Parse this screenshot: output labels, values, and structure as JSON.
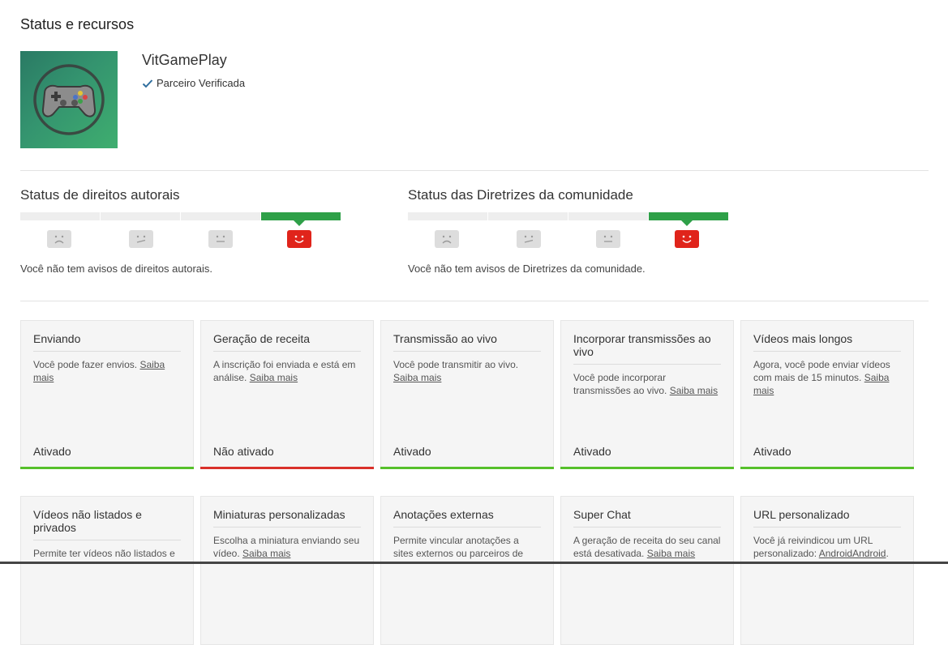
{
  "page": {
    "title": "Status e recursos"
  },
  "channel": {
    "name": "VitGamePlay",
    "partner_label": "Parceiro Verificada"
  },
  "colors": {
    "active_segment": "#2ea048",
    "active_face": "#e0241b",
    "enabled_bar": "#56c02b",
    "disabled_bar": "#d9302a"
  },
  "copyright": {
    "title": "Status de direitos autorais",
    "message": "Você não tem avisos de direitos autorais.",
    "level": 4
  },
  "community": {
    "title": "Status das Diretrizes da comunidade",
    "message": "Você não tem avisos de Diretrizes da comunidade.",
    "level": 4
  },
  "features": [
    {
      "title": "Enviando",
      "desc": "Você pode fazer envios.",
      "link": "Saiba mais",
      "status": "Ativado"
    },
    {
      "title": "Geração de receita",
      "desc": "A inscrição foi enviada e está em análise.",
      "link": "Saiba mais",
      "status": "Não ativado"
    },
    {
      "title": "Transmissão ao vivo",
      "desc": "Você pode transmitir ao vivo.",
      "link": "Saiba mais",
      "status": "Ativado"
    },
    {
      "title": "Incorporar transmissões ao vivo",
      "desc": "Você pode incorporar transmissões ao vivo.",
      "link": "Saiba mais",
      "status": "Ativado"
    },
    {
      "title": "Vídeos mais longos",
      "desc": "Agora, você pode enviar vídeos com mais de 15 minutos.",
      "link": "Saiba mais",
      "status": "Ativado"
    },
    {
      "title": "Vídeos não listados e privados",
      "desc": "Permite ter vídeos não listados e",
      "link": ""
    },
    {
      "title": "Miniaturas personalizadas",
      "desc": "Escolha a miniatura enviando seu vídeo.",
      "link": "Saiba mais"
    },
    {
      "title": "Anotações externas",
      "desc": "Permite vincular anotações a sites externos ou parceiros de",
      "link": ""
    },
    {
      "title": "Super Chat",
      "desc": "A geração de receita do seu canal está desativada.",
      "link": "Saiba mais"
    },
    {
      "title": "URL personalizado",
      "desc": "Você já reivindicou um URL personalizado:",
      "link": "AndroidAndroid",
      "suffix": "."
    }
  ]
}
